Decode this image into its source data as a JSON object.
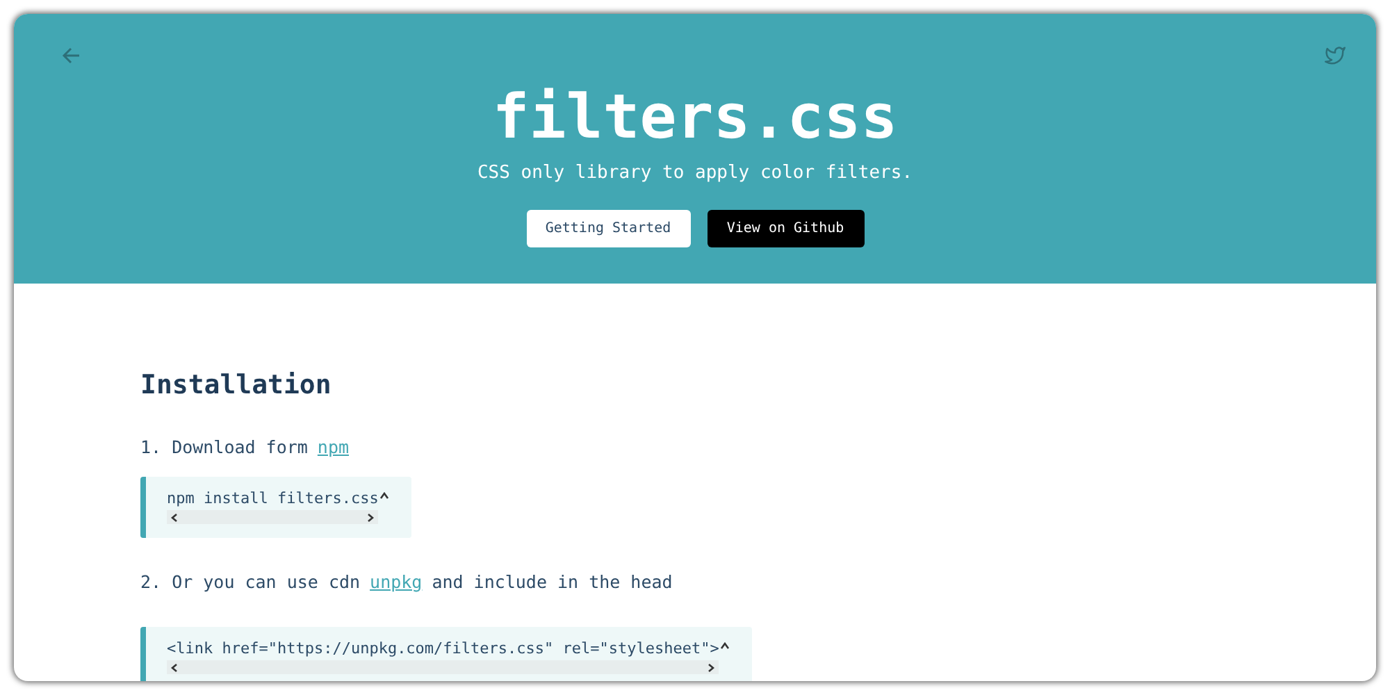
{
  "header": {
    "title": "filters.css",
    "subtitle": "CSS only library to apply color filters.",
    "buttons": [
      {
        "label": "Getting Started",
        "kind": "light"
      },
      {
        "label": "View on Github",
        "kind": "dark"
      }
    ]
  },
  "content": {
    "heading": "Installation",
    "steps": [
      {
        "number": "1.",
        "before": "Download form",
        "link": "npm",
        "code": "npm install filters.css"
      },
      {
        "number": "2.",
        "before": "Or you can use cdn",
        "link": "unpkg",
        "after": "and include in the head",
        "code": "<link href=\"https://unpkg.com/filters.css\" rel=\"stylesheet\">"
      }
    ]
  }
}
